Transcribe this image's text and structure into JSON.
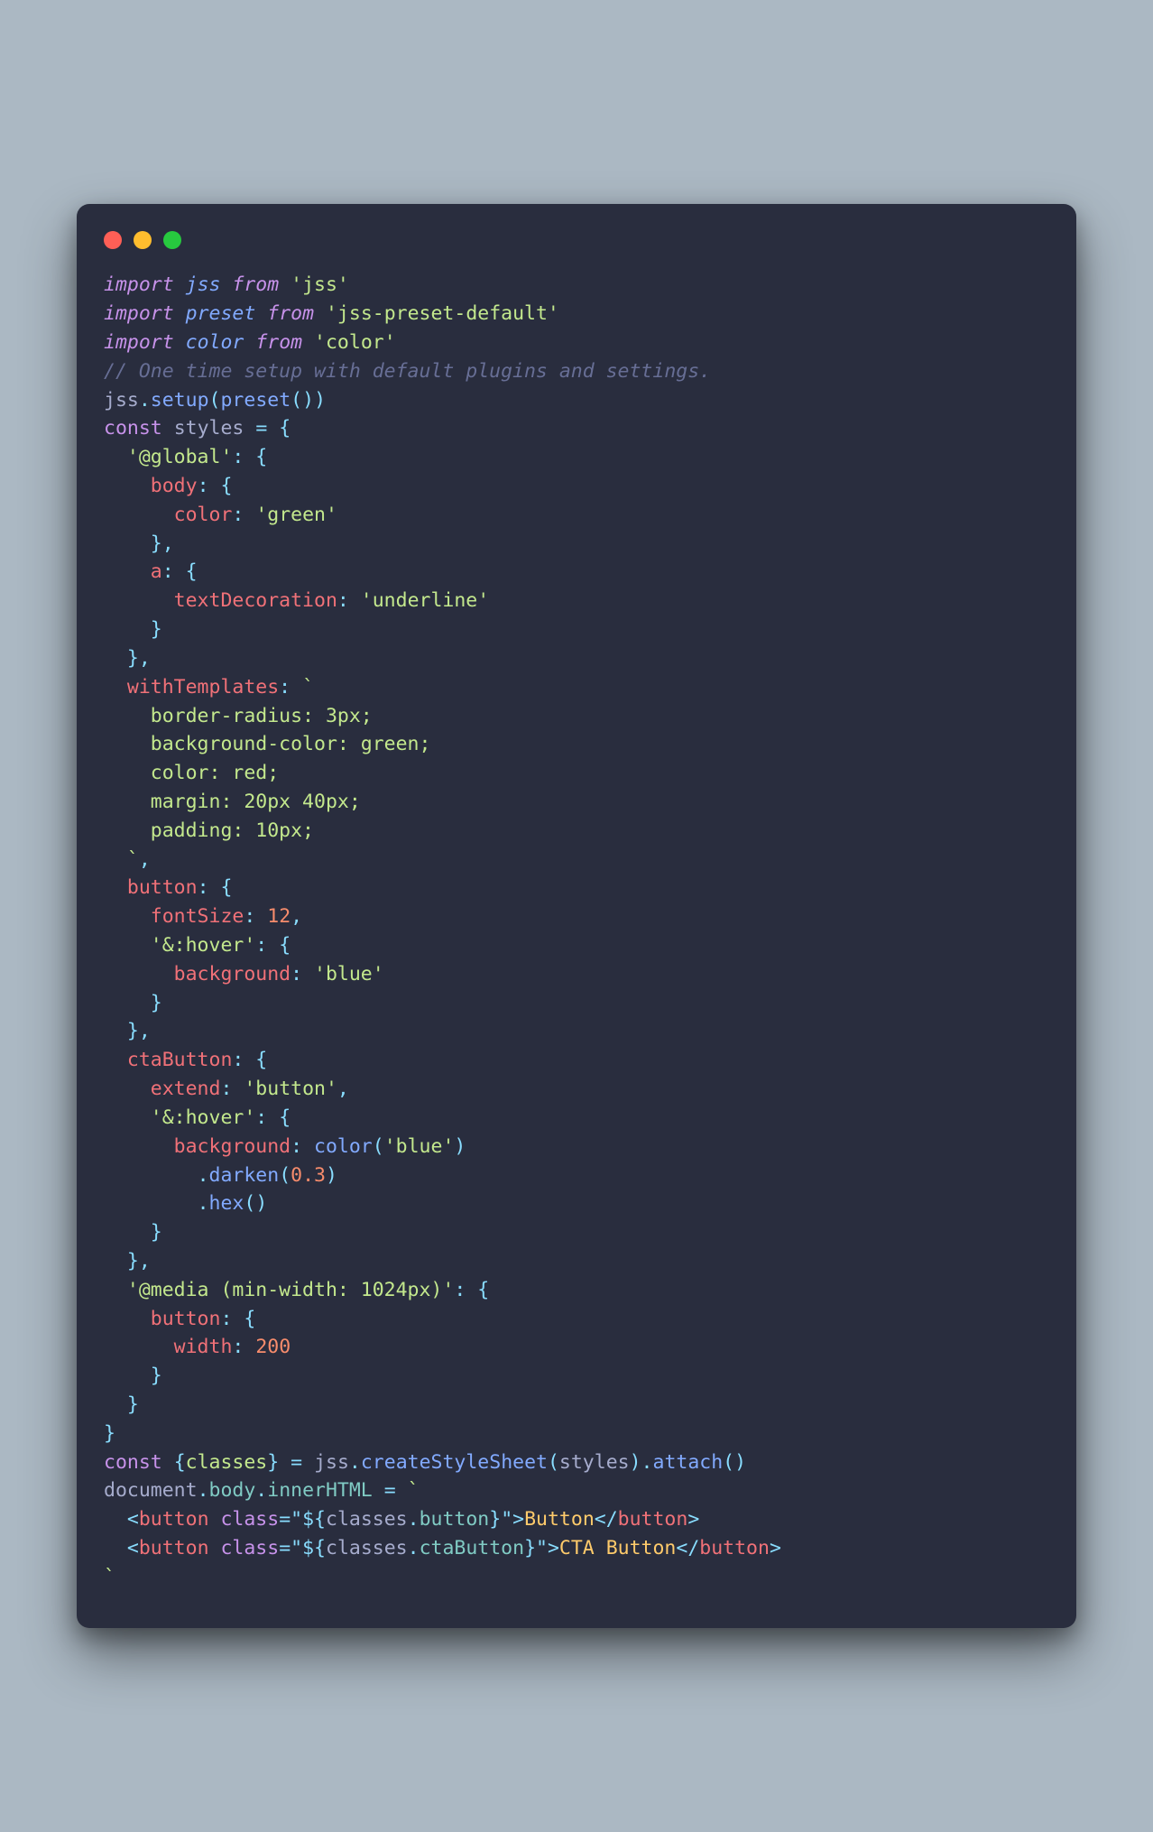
{
  "tokens": [
    [
      [
        "tk-import",
        "import"
      ],
      [
        "",
        " "
      ],
      [
        "tk-module",
        "jss"
      ],
      [
        "",
        " "
      ],
      [
        "tk-from",
        "from"
      ],
      [
        "",
        " "
      ],
      [
        "tk-string",
        "'jss'"
      ]
    ],
    [
      [
        "tk-import",
        "import"
      ],
      [
        "",
        " "
      ],
      [
        "tk-module",
        "preset"
      ],
      [
        "",
        " "
      ],
      [
        "tk-from",
        "from"
      ],
      [
        "",
        " "
      ],
      [
        "tk-string",
        "'jss-preset-default'"
      ]
    ],
    [
      [
        "tk-import",
        "import"
      ],
      [
        "",
        " "
      ],
      [
        "tk-module",
        "color"
      ],
      [
        "",
        " "
      ],
      [
        "tk-from",
        "from"
      ],
      [
        "",
        " "
      ],
      [
        "tk-string",
        "'color'"
      ]
    ],
    [
      [
        "tk-comment",
        "// One time setup with default plugins and settings."
      ]
    ],
    [
      [
        "tk-ident",
        "jss"
      ],
      [
        "tk-punct",
        "."
      ],
      [
        "tk-func",
        "setup"
      ],
      [
        "tk-punct",
        "("
      ],
      [
        "tk-func",
        "preset"
      ],
      [
        "tk-punct",
        "("
      ],
      [
        "tk-punct",
        ")"
      ],
      [
        "tk-punct",
        ")"
      ]
    ],
    [
      [
        "tk-keyword",
        "const"
      ],
      [
        "",
        " "
      ],
      [
        "tk-ident",
        "styles"
      ],
      [
        "",
        " "
      ],
      [
        "tk-operator",
        "="
      ],
      [
        "",
        " "
      ],
      [
        "tk-punct",
        "{"
      ]
    ],
    [
      [
        "",
        "  "
      ],
      [
        "tk-string",
        "'@global'"
      ],
      [
        "tk-operator",
        ":"
      ],
      [
        "",
        " "
      ],
      [
        "tk-punct",
        "{"
      ]
    ],
    [
      [
        "",
        "    "
      ],
      [
        "tk-pink",
        "body"
      ],
      [
        "tk-operator",
        ":"
      ],
      [
        "",
        " "
      ],
      [
        "tk-punct",
        "{"
      ]
    ],
    [
      [
        "",
        "      "
      ],
      [
        "tk-pink",
        "color"
      ],
      [
        "tk-operator",
        ":"
      ],
      [
        "",
        " "
      ],
      [
        "tk-string",
        "'green'"
      ]
    ],
    [
      [
        "",
        "    "
      ],
      [
        "tk-punct",
        "}"
      ],
      [
        "tk-punct",
        ","
      ]
    ],
    [
      [
        "",
        "    "
      ],
      [
        "tk-pink",
        "a"
      ],
      [
        "tk-operator",
        ":"
      ],
      [
        "",
        " "
      ],
      [
        "tk-punct",
        "{"
      ]
    ],
    [
      [
        "",
        "      "
      ],
      [
        "tk-pink",
        "textDecoration"
      ],
      [
        "tk-operator",
        ":"
      ],
      [
        "",
        " "
      ],
      [
        "tk-string",
        "'underline'"
      ]
    ],
    [
      [
        "",
        "    "
      ],
      [
        "tk-punct",
        "}"
      ]
    ],
    [
      [
        "",
        "  "
      ],
      [
        "tk-punct",
        "}"
      ],
      [
        "tk-punct",
        ","
      ]
    ],
    [
      [
        "",
        "  "
      ],
      [
        "tk-pink",
        "withTemplates"
      ],
      [
        "tk-operator",
        ":"
      ],
      [
        "",
        " "
      ],
      [
        "tk-string",
        "`"
      ]
    ],
    [
      [
        "tk-string",
        "    border-radius: 3px;"
      ]
    ],
    [
      [
        "tk-string",
        "    background-color: green;"
      ]
    ],
    [
      [
        "tk-string",
        "    color: red;"
      ]
    ],
    [
      [
        "tk-string",
        "    margin: 20px 40px;"
      ]
    ],
    [
      [
        "tk-string",
        "    padding: 10px;"
      ]
    ],
    [
      [
        "tk-string",
        "  `"
      ],
      [
        "tk-punct",
        ","
      ]
    ],
    [
      [
        "",
        "  "
      ],
      [
        "tk-pink",
        "button"
      ],
      [
        "tk-operator",
        ":"
      ],
      [
        "",
        " "
      ],
      [
        "tk-punct",
        "{"
      ]
    ],
    [
      [
        "",
        "    "
      ],
      [
        "tk-pink",
        "fontSize"
      ],
      [
        "tk-operator",
        ":"
      ],
      [
        "",
        " "
      ],
      [
        "tk-number",
        "12"
      ],
      [
        "tk-punct",
        ","
      ]
    ],
    [
      [
        "",
        "    "
      ],
      [
        "tk-string",
        "'&:hover'"
      ],
      [
        "tk-operator",
        ":"
      ],
      [
        "",
        " "
      ],
      [
        "tk-punct",
        "{"
      ]
    ],
    [
      [
        "",
        "      "
      ],
      [
        "tk-pink",
        "background"
      ],
      [
        "tk-operator",
        ":"
      ],
      [
        "",
        " "
      ],
      [
        "tk-string",
        "'blue'"
      ]
    ],
    [
      [
        "",
        "    "
      ],
      [
        "tk-punct",
        "}"
      ]
    ],
    [
      [
        "",
        "  "
      ],
      [
        "tk-punct",
        "}"
      ],
      [
        "tk-punct",
        ","
      ]
    ],
    [
      [
        "",
        "  "
      ],
      [
        "tk-pink",
        "ctaButton"
      ],
      [
        "tk-operator",
        ":"
      ],
      [
        "",
        " "
      ],
      [
        "tk-punct",
        "{"
      ]
    ],
    [
      [
        "",
        "    "
      ],
      [
        "tk-pink",
        "extend"
      ],
      [
        "tk-operator",
        ":"
      ],
      [
        "",
        " "
      ],
      [
        "tk-string",
        "'button'"
      ],
      [
        "tk-punct",
        ","
      ]
    ],
    [
      [
        "",
        "    "
      ],
      [
        "tk-string",
        "'&:hover'"
      ],
      [
        "tk-operator",
        ":"
      ],
      [
        "",
        " "
      ],
      [
        "tk-punct",
        "{"
      ]
    ],
    [
      [
        "",
        "      "
      ],
      [
        "tk-pink",
        "background"
      ],
      [
        "tk-operator",
        ":"
      ],
      [
        "",
        " "
      ],
      [
        "tk-func",
        "color"
      ],
      [
        "tk-punct",
        "("
      ],
      [
        "tk-string",
        "'blue'"
      ],
      [
        "tk-punct",
        ")"
      ]
    ],
    [
      [
        "",
        "        "
      ],
      [
        "tk-punct",
        "."
      ],
      [
        "tk-func",
        "darken"
      ],
      [
        "tk-punct",
        "("
      ],
      [
        "tk-number",
        "0.3"
      ],
      [
        "tk-punct",
        ")"
      ]
    ],
    [
      [
        "",
        "        "
      ],
      [
        "tk-punct",
        "."
      ],
      [
        "tk-func",
        "hex"
      ],
      [
        "tk-punct",
        "("
      ],
      [
        "tk-punct",
        ")"
      ]
    ],
    [
      [
        "",
        "    "
      ],
      [
        "tk-punct",
        "}"
      ]
    ],
    [
      [
        "",
        "  "
      ],
      [
        "tk-punct",
        "}"
      ],
      [
        "tk-punct",
        ","
      ]
    ],
    [
      [
        "",
        "  "
      ],
      [
        "tk-string",
        "'@media (min-width: 1024px)'"
      ],
      [
        "tk-operator",
        ":"
      ],
      [
        "",
        " "
      ],
      [
        "tk-punct",
        "{"
      ]
    ],
    [
      [
        "",
        "    "
      ],
      [
        "tk-pink",
        "button"
      ],
      [
        "tk-operator",
        ":"
      ],
      [
        "",
        " "
      ],
      [
        "tk-punct",
        "{"
      ]
    ],
    [
      [
        "",
        "      "
      ],
      [
        "tk-pink",
        "width"
      ],
      [
        "tk-operator",
        ":"
      ],
      [
        "",
        " "
      ],
      [
        "tk-number",
        "200"
      ]
    ],
    [
      [
        "",
        "    "
      ],
      [
        "tk-punct",
        "}"
      ]
    ],
    [
      [
        "",
        "  "
      ],
      [
        "tk-punct",
        "}"
      ]
    ],
    [
      [
        "tk-punct",
        "}"
      ]
    ],
    [
      [
        "tk-keyword",
        "const"
      ],
      [
        "",
        " "
      ],
      [
        "tk-punct",
        "{"
      ],
      [
        "tk-green",
        "classes"
      ],
      [
        "tk-punct",
        "}"
      ],
      [
        "",
        " "
      ],
      [
        "tk-operator",
        "="
      ],
      [
        "",
        " "
      ],
      [
        "tk-ident",
        "jss"
      ],
      [
        "tk-punct",
        "."
      ],
      [
        "tk-func",
        "createStyleSheet"
      ],
      [
        "tk-punct",
        "("
      ],
      [
        "tk-ident",
        "styles"
      ],
      [
        "tk-punct",
        ")"
      ],
      [
        "tk-punct",
        "."
      ],
      [
        "tk-func",
        "attach"
      ],
      [
        "tk-punct",
        "("
      ],
      [
        "tk-punct",
        ")"
      ]
    ],
    [
      [
        "tk-ident",
        "document"
      ],
      [
        "tk-punct",
        "."
      ],
      [
        "tk-prop",
        "body"
      ],
      [
        "tk-punct",
        "."
      ],
      [
        "tk-prop",
        "innerHTML"
      ],
      [
        "",
        " "
      ],
      [
        "tk-operator",
        "="
      ],
      [
        "",
        " "
      ],
      [
        "tk-string",
        "`"
      ]
    ],
    [
      [
        "tk-string",
        "  "
      ],
      [
        "tk-punct",
        "<"
      ],
      [
        "tk-tag",
        "button"
      ],
      [
        "tk-string",
        " "
      ],
      [
        "tk-attr",
        "class"
      ],
      [
        "tk-punct",
        "="
      ],
      [
        "tk-punct",
        "\""
      ],
      [
        "tk-interp",
        "${"
      ],
      [
        "tk-ident",
        "classes"
      ],
      [
        "tk-punct",
        "."
      ],
      [
        "tk-prop",
        "button"
      ],
      [
        "tk-interp",
        "}"
      ],
      [
        "tk-punct",
        "\""
      ],
      [
        "tk-punct",
        ">"
      ],
      [
        "tk-yellow",
        "Button"
      ],
      [
        "tk-punct",
        "</"
      ],
      [
        "tk-tag",
        "button"
      ],
      [
        "tk-punct",
        ">"
      ]
    ],
    [
      [
        "tk-string",
        "  "
      ],
      [
        "tk-punct",
        "<"
      ],
      [
        "tk-tag",
        "button"
      ],
      [
        "tk-string",
        " "
      ],
      [
        "tk-attr",
        "class"
      ],
      [
        "tk-punct",
        "="
      ],
      [
        "tk-punct",
        "\""
      ],
      [
        "tk-interp",
        "${"
      ],
      [
        "tk-ident",
        "classes"
      ],
      [
        "tk-punct",
        "."
      ],
      [
        "tk-prop",
        "ctaButton"
      ],
      [
        "tk-interp",
        "}"
      ],
      [
        "tk-punct",
        "\""
      ],
      [
        "tk-punct",
        ">"
      ],
      [
        "tk-yellow",
        "CTA Button"
      ],
      [
        "tk-punct",
        "</"
      ],
      [
        "tk-tag",
        "button"
      ],
      [
        "tk-punct",
        ">"
      ]
    ],
    [
      [
        "tk-string",
        "`"
      ]
    ]
  ]
}
